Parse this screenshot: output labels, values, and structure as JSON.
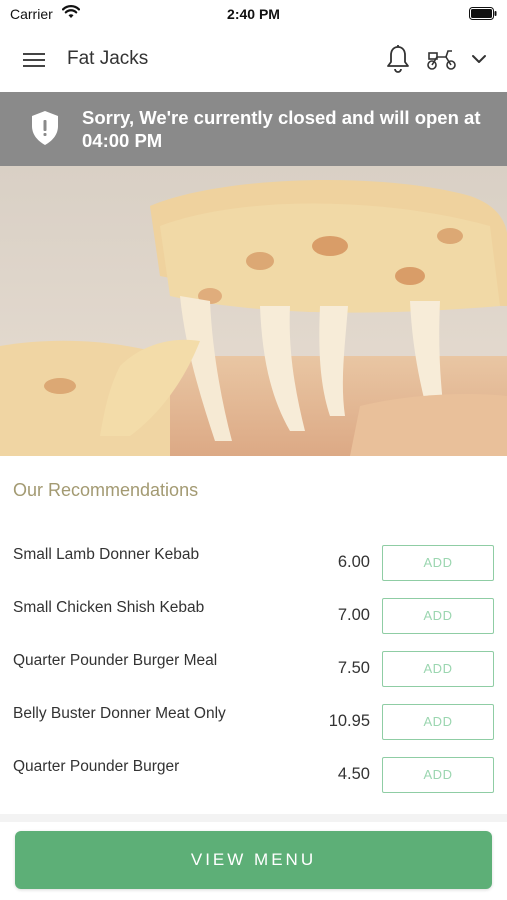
{
  "status_bar": {
    "carrier": "Carrier",
    "time": "2:40 PM"
  },
  "header": {
    "title": "Fat Jacks",
    "icons": [
      "menu-icon",
      "bell-icon",
      "delivery-scooter-icon",
      "chevron-down-icon"
    ]
  },
  "banner": {
    "message": "Sorry, We're currently closed and will open at 04:00 PM",
    "icon": "shield-alert-icon"
  },
  "hero": {
    "icon": "pizza-photo"
  },
  "recommendations": {
    "title": "Our Recommendations",
    "items": [
      {
        "name": "Small Lamb Donner Kebab",
        "price": "6.00",
        "add_label": "ADD"
      },
      {
        "name": "Small Chicken Shish Kebab",
        "price": "7.00",
        "add_label": "ADD"
      },
      {
        "name": "Quarter Pounder Burger Meal",
        "price": "7.50",
        "add_label": "ADD"
      },
      {
        "name": "Belly Buster Donner Meat Only",
        "price": "10.95",
        "add_label": "ADD"
      },
      {
        "name": "Quarter Pounder Burger",
        "price": "4.50",
        "add_label": "ADD"
      }
    ]
  },
  "footer": {
    "view_menu_label": "VIEW MENU"
  },
  "colors": {
    "accent_green": "#5daf77",
    "banner_gray": "#8a8a8a",
    "heading_gold": "#a39a72"
  }
}
